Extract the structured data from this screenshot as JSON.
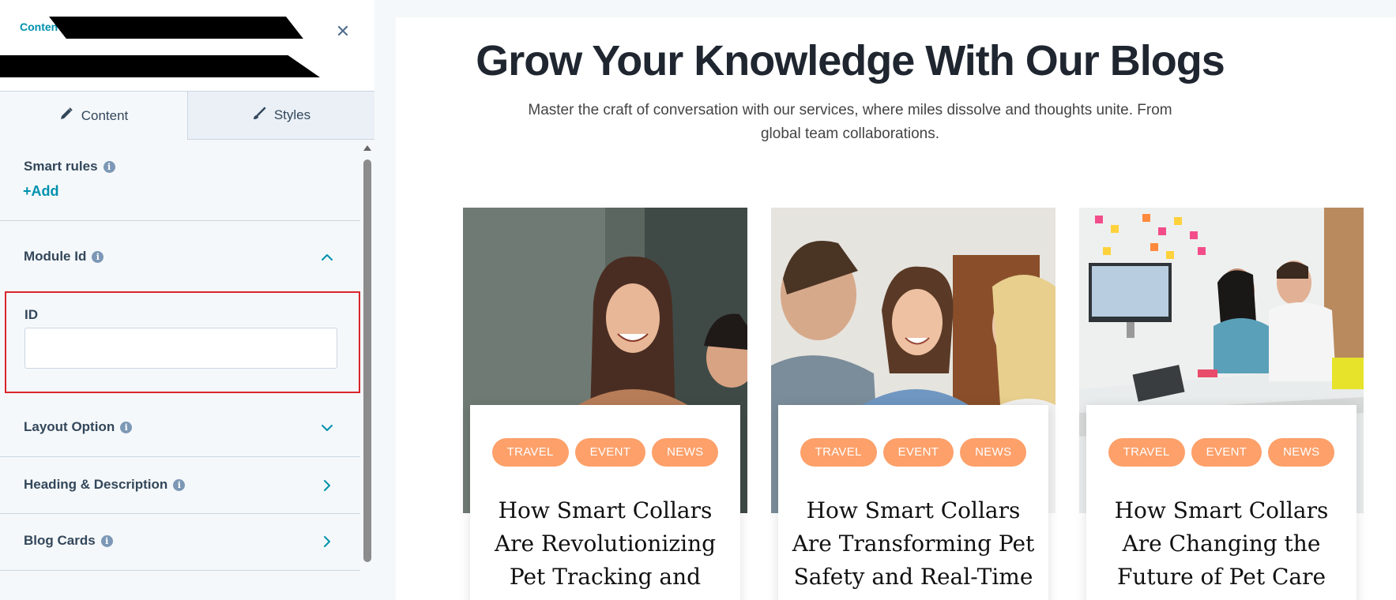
{
  "panel": {
    "breadcrumb": "Conten",
    "close_icon": "close-icon",
    "tabs": [
      {
        "label": "Content",
        "icon": "pencil-icon",
        "active": true
      },
      {
        "label": "Styles",
        "icon": "brush-icon",
        "active": false
      }
    ],
    "smart_rules": {
      "title": "Smart rules",
      "add_label": "+Add"
    },
    "module_id": {
      "title": "Module Id",
      "expanded": true,
      "id_label": "ID",
      "id_value": ""
    },
    "layout_option": {
      "title": "Layout Option",
      "expanded": false
    },
    "heading_description": {
      "title": "Heading & Description"
    },
    "blog_cards": {
      "title": "Blog Cards"
    }
  },
  "preview": {
    "title": "Grow Your Knowledge With Our Blogs",
    "description": "Master the craft of conversation with our services, where miles dissolve and thoughts unite. From global team collaborations.",
    "cards": [
      {
        "tags": [
          "TRAVEL",
          "EVENT",
          "NEWS"
        ],
        "title": "How Smart Collars Are Revolutionizing Pet Tracking and Health Monitoring"
      },
      {
        "tags": [
          "TRAVEL",
          "EVENT",
          "NEWS"
        ],
        "title": "How Smart Collars Are Transforming Pet Safety and Real-Time Health"
      },
      {
        "tags": [
          "TRAVEL",
          "EVENT",
          "NEWS"
        ],
        "title": "How Smart Collars Are Changing the Future of Pet Care and Location"
      }
    ]
  },
  "colors": {
    "accent": "#0091ae",
    "tag": "#fda06a",
    "highlight_border": "#d9262b"
  }
}
